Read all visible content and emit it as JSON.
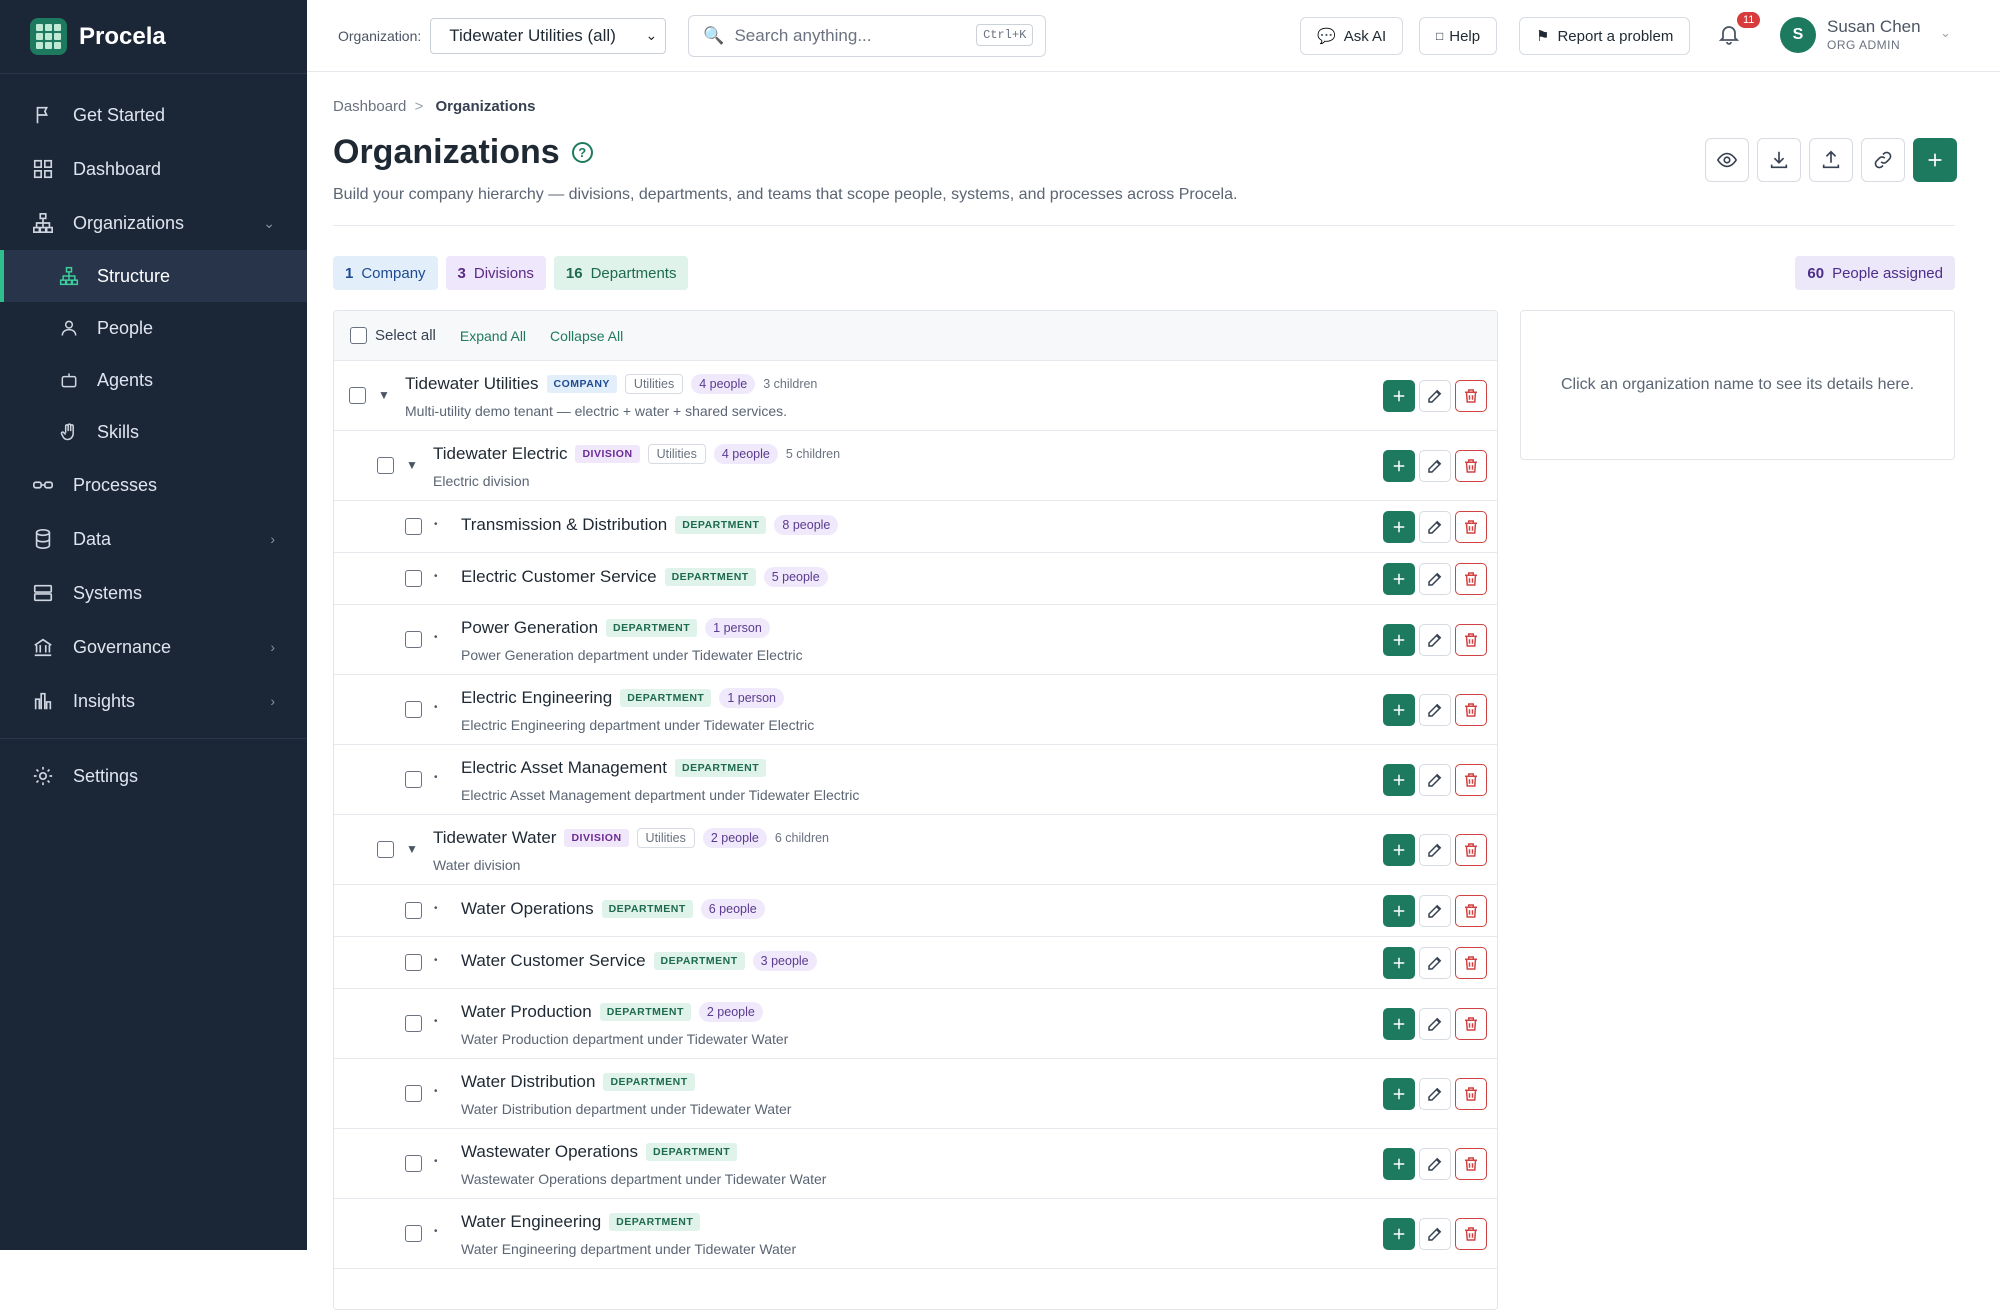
{
  "app": {
    "name": "Procela"
  },
  "sidebar": {
    "items": [
      {
        "label": "Get Started",
        "icon": "flag-icon"
      },
      {
        "label": "Dashboard",
        "icon": "grid-icon"
      },
      {
        "label": "Organizations",
        "icon": "hierarchy-icon"
      },
      {
        "label": "Structure",
        "icon": "hierarchy-icon"
      },
      {
        "label": "People",
        "icon": "person-icon"
      },
      {
        "label": "Agents",
        "icon": "robot-icon"
      },
      {
        "label": "Skills",
        "icon": "hand-icon"
      },
      {
        "label": "Processes",
        "icon": "glasses-icon"
      },
      {
        "label": "Data",
        "icon": "database-icon"
      },
      {
        "label": "Systems",
        "icon": "server-icon"
      },
      {
        "label": "Governance",
        "icon": "bank-icon"
      },
      {
        "label": "Insights",
        "icon": "bar-chart-icon"
      },
      {
        "label": "Settings",
        "icon": "gear-icon"
      }
    ]
  },
  "topbar": {
    "org_label": "Organization:",
    "org_value": "Tidewater Utilities (all)",
    "search_placeholder": "Search anything...",
    "search_shortcut": "Ctrl+K",
    "ask_ai": "Ask AI",
    "help": "Help",
    "report": "Report a problem",
    "notif_count": "11",
    "user_initial": "S",
    "user_name": "Susan Chen",
    "user_role": "ORG ADMIN"
  },
  "page": {
    "breadcrumb_root": "Dashboard",
    "breadcrumb_sep": ">",
    "breadcrumb_current": "Organizations",
    "title": "Organizations",
    "help_glyph": "?",
    "subtitle": "Build your company hierarchy — divisions, departments, and teams that scope people, systems, and processes across Procela."
  },
  "stats": {
    "company_count": "1",
    "company_label": "Company",
    "division_count": "3",
    "division_label": "Divisions",
    "department_count": "16",
    "department_label": "Departments",
    "assigned_count": "60",
    "assigned_label": "People assigned"
  },
  "tree": {
    "select_all": "Select all",
    "expand_all": "Expand All",
    "collapse_all": "Collapse All",
    "rows": [
      {
        "name": "Tidewater Utilities",
        "type": "COMPANY",
        "industry": "Utilities",
        "people": "4 people",
        "children": "3 children",
        "desc": "Multi-utility demo tenant — electric + water + shared services.",
        "level": 0
      },
      {
        "name": "Tidewater Electric",
        "type": "DIVISION",
        "industry": "Utilities",
        "people": "4 people",
        "children": "5 children",
        "desc": "Electric division",
        "level": 1
      },
      {
        "name": "Transmission & Distribution",
        "type": "DEPARTMENT",
        "people": "8 people",
        "desc": "",
        "level": 2
      },
      {
        "name": "Electric Customer Service",
        "type": "DEPARTMENT",
        "people": "5 people",
        "desc": "",
        "level": 2
      },
      {
        "name": "Power Generation",
        "type": "DEPARTMENT",
        "people": "1 person",
        "desc": "Power Generation department under Tidewater Electric",
        "level": 2
      },
      {
        "name": "Electric Engineering",
        "type": "DEPARTMENT",
        "people": "1 person",
        "desc": "Electric Engineering department under Tidewater Electric",
        "level": 2
      },
      {
        "name": "Electric Asset Management",
        "type": "DEPARTMENT",
        "people": "",
        "desc": "Electric Asset Management department under Tidewater Electric",
        "level": 2
      },
      {
        "name": "Tidewater Water",
        "type": "DIVISION",
        "industry": "Utilities",
        "people": "2 people",
        "children": "6 children",
        "desc": "Water division",
        "level": 1
      },
      {
        "name": "Water Operations",
        "type": "DEPARTMENT",
        "people": "6 people",
        "desc": "",
        "level": 2
      },
      {
        "name": "Water Customer Service",
        "type": "DEPARTMENT",
        "people": "3 people",
        "desc": "",
        "level": 2
      },
      {
        "name": "Water Production",
        "type": "DEPARTMENT",
        "people": "2 people",
        "desc": "Water Production department under Tidewater Water",
        "level": 2
      },
      {
        "name": "Water Distribution",
        "type": "DEPARTMENT",
        "people": "",
        "desc": "Water Distribution department under Tidewater Water",
        "level": 2
      },
      {
        "name": "Wastewater Operations",
        "type": "DEPARTMENT",
        "people": "",
        "desc": "Wastewater Operations department under Tidewater Water",
        "level": 2
      },
      {
        "name": "Water Engineering",
        "type": "DEPARTMENT",
        "people": "",
        "desc": "Water Engineering department under Tidewater Water",
        "level": 2
      }
    ]
  },
  "details": {
    "placeholder": "Click an organization name to see its details here."
  },
  "colors": {
    "brand": "#1e7a5e",
    "sidebar_bg": "#1b2637",
    "danger": "#d14343"
  }
}
